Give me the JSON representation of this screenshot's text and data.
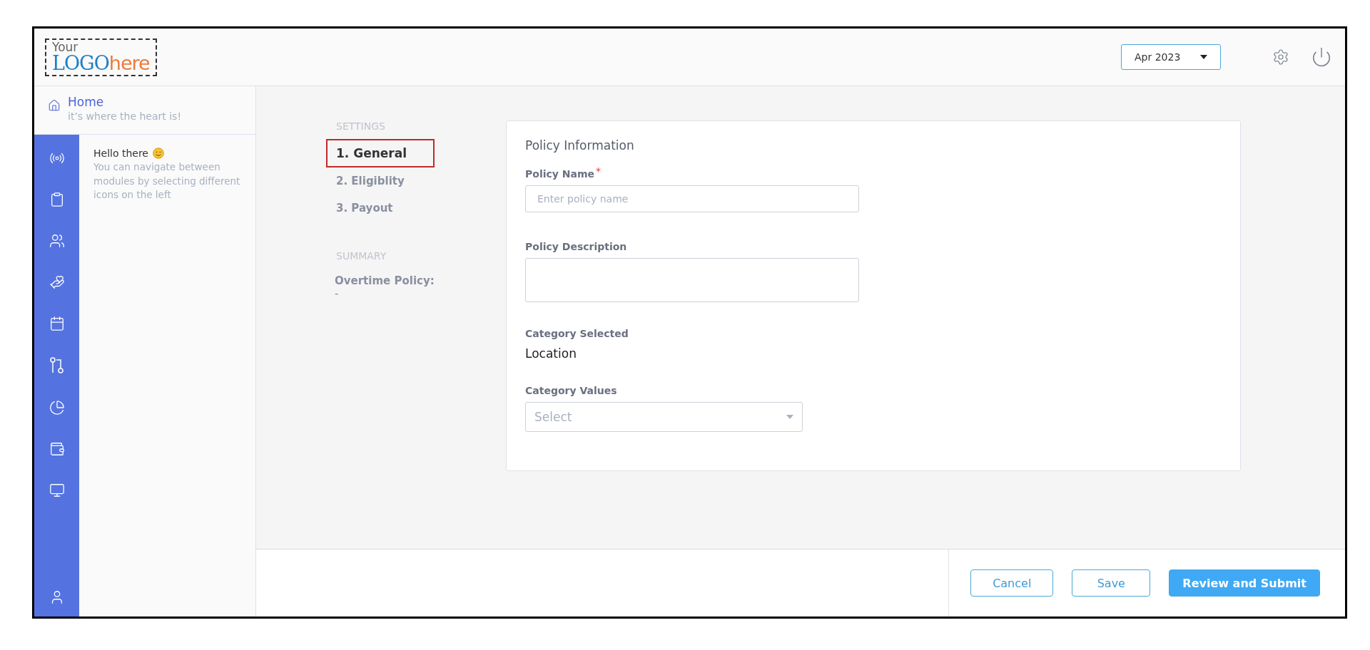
{
  "logo": {
    "top": "Your",
    "brand": "LOGO",
    "suffix": "here"
  },
  "header": {
    "period": "Apr 2023"
  },
  "home": {
    "title": "Home",
    "subtitle": "it’s where the heart is!"
  },
  "rail": [
    {
      "kind": "radio"
    },
    {
      "kind": "clipboard"
    },
    {
      "kind": "users"
    },
    {
      "kind": "hand"
    },
    {
      "kind": "calendar"
    },
    {
      "kind": "route"
    },
    {
      "kind": "pie"
    },
    {
      "kind": "wallet"
    },
    {
      "kind": "monitor"
    }
  ],
  "rail_bottom": {
    "kind": "user"
  },
  "welcome": {
    "title": "Hello there",
    "text": "You can navigate between modules by selecting different icons on the left"
  },
  "steps_heading": "SETTINGS",
  "steps": [
    {
      "label": "1. General",
      "selected": true
    },
    {
      "label": "2. Eligiblity",
      "selected": false
    },
    {
      "label": "3. Payout",
      "selected": false
    }
  ],
  "summary": {
    "heading": "SUMMARY",
    "label": "Overtime Policy:",
    "value": "-"
  },
  "form": {
    "title": "Policy Information",
    "fields": [
      {
        "kind": "input",
        "label": "Policy Name",
        "required_mark": "*",
        "placeholder": "Enter policy name"
      },
      {
        "kind": "textarea",
        "label": "Policy Description"
      },
      {
        "kind": "static",
        "label": "Category Selected",
        "value": "Location"
      },
      {
        "kind": "select",
        "label": "Category Values",
        "placeholder": "Select"
      }
    ]
  },
  "footer": {
    "buttons": [
      {
        "label": "Cancel",
        "kind": "outline"
      },
      {
        "label": "Save",
        "kind": "outline"
      },
      {
        "label": "Review and Submit",
        "kind": "primary"
      }
    ]
  }
}
